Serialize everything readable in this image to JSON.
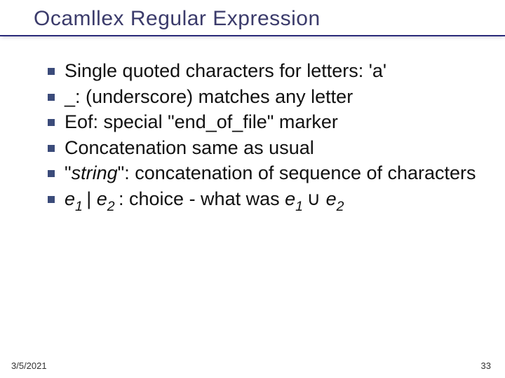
{
  "title": "Ocamllex Regular Expression",
  "bullets": [
    {
      "html": "Single quoted characters for letters: 'a'"
    },
    {
      "html": "_: (underscore) matches any letter"
    },
    {
      "html": "Eof: special \"end_of_file\" marker"
    },
    {
      "html": "Concatenation same as usual"
    },
    {
      "html": "\"<span class='italic'>string</span>\": concatenation of sequence of characters"
    },
    {
      "html": "<span class='italic'>e<span class='sub'>1 </span></span>| <span class='italic'>e<span class='sub'>2 </span></span>: choice - what was <span class='italic'>e<span class='sub'>1 </span></span><span class='union'>&#x222A;</span> <span class='italic'>e<span class='sub'>2</span></span>"
    }
  ],
  "footer": {
    "date": "3/5/2021",
    "page": "33"
  }
}
